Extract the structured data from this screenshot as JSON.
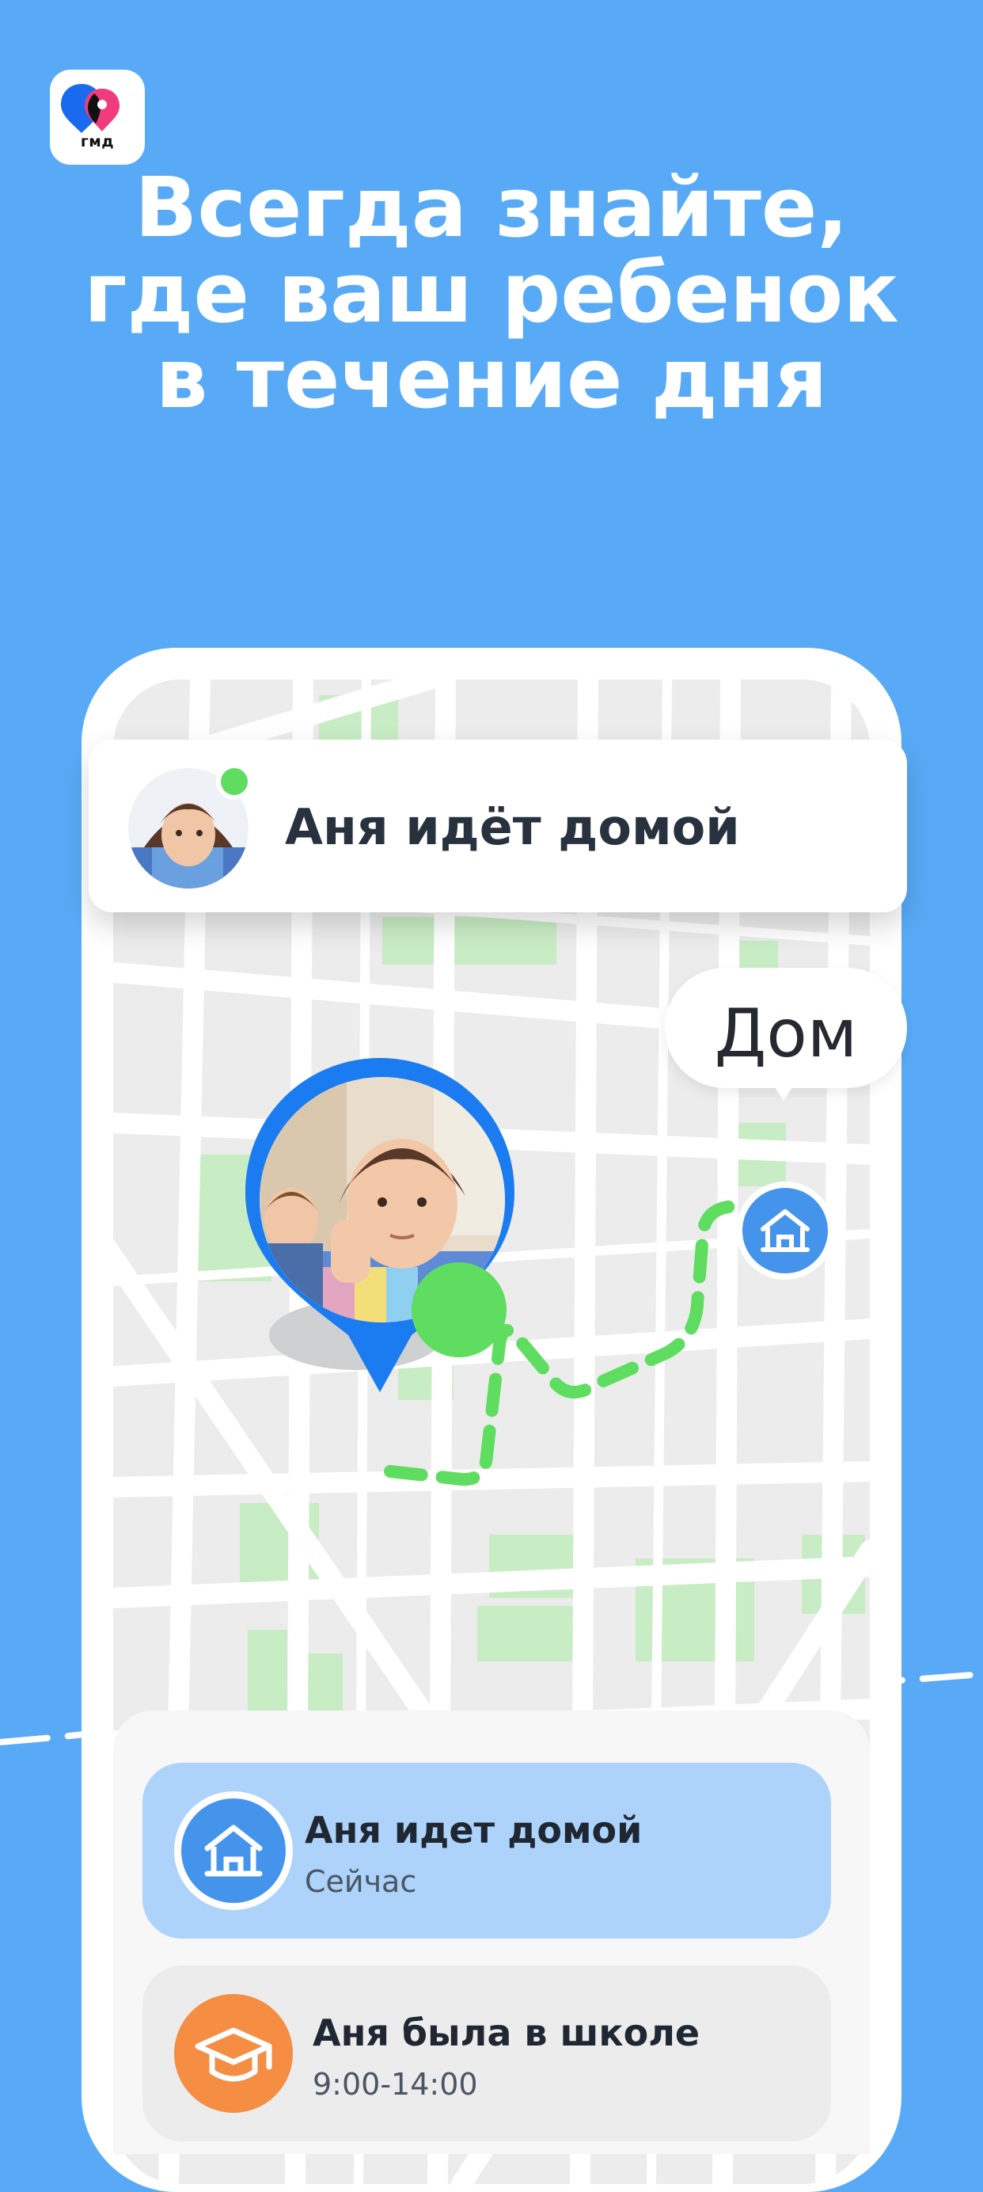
{
  "logo": {
    "text": "гмд",
    "icon": "app-logo-icon"
  },
  "headline": {
    "lines": [
      "Всегда знайте,",
      "где ваш ребенок",
      "в течение дня"
    ]
  },
  "notification": {
    "text": "Аня идёт домой",
    "avatar_icon": "child-avatar",
    "status_color": "#5edd60"
  },
  "map": {
    "home_label": "Дом",
    "home_icon": "house-icon",
    "route_color": "#5edd60",
    "pin_color": "#1a7cf0"
  },
  "timeline": {
    "events": [
      {
        "title": "Аня идет домой",
        "subtitle": "Сейчас",
        "icon": "house-icon",
        "color": "#4494ec"
      },
      {
        "title": "Аня была в школе",
        "subtitle": "9:00-14:00",
        "icon": "graduation-cap-icon",
        "color": "#f58d43"
      }
    ]
  },
  "colors": {
    "background": "#58aaf7",
    "active_card": "#add3fb",
    "route": "#5edd60"
  }
}
